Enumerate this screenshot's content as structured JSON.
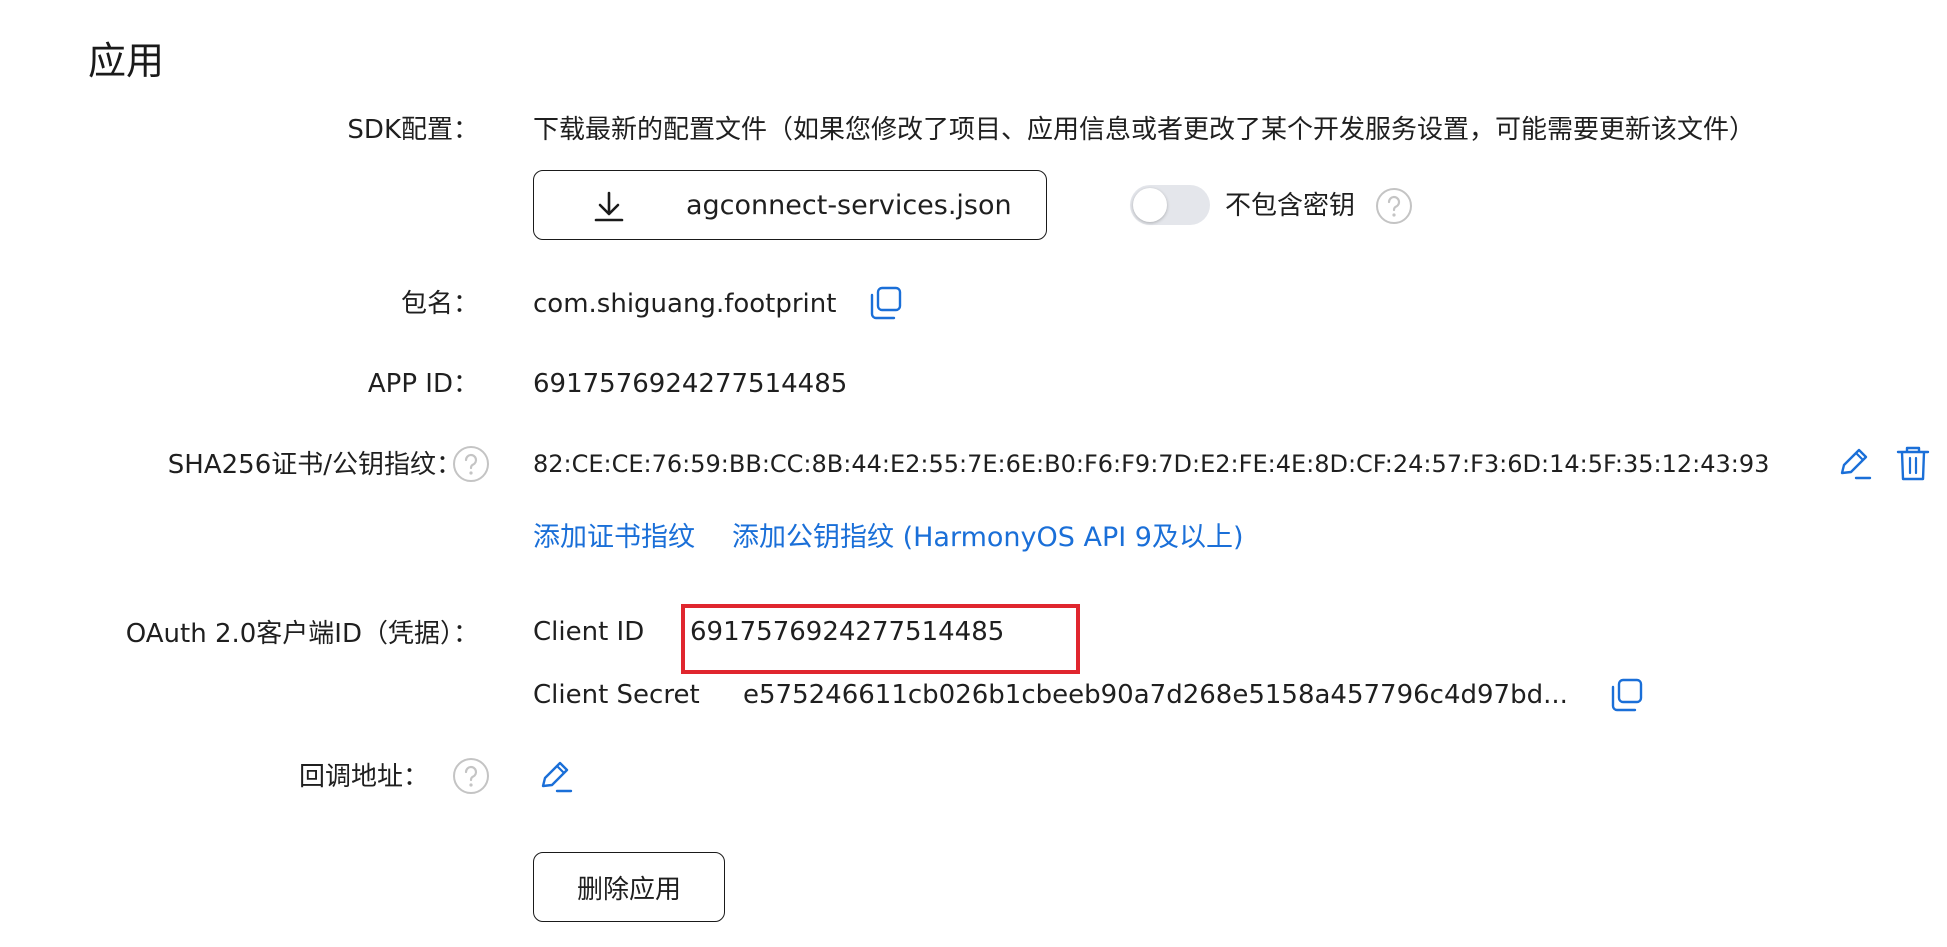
{
  "section": {
    "title": "应用"
  },
  "sdk": {
    "label": "SDK配置：",
    "description": "下载最新的配置文件（如果您修改了项目、应用信息或者更改了某个开发服务设置，可能需要更新该文件）",
    "download_label": "agconnect-services.json",
    "toggle_label": "不包含密钥",
    "toggle_on": false
  },
  "package": {
    "label": "包名：",
    "value": "com.shiguang.footprint"
  },
  "app_id": {
    "label": "APP ID：",
    "value": "6917576924277514485"
  },
  "sha256": {
    "label": "SHA256证书/公钥指纹：",
    "value": "82:CE:CE:76:59:BB:CC:8B:44:E2:55:7E:6E:B0:F6:F9:7D:E2:FE:4E:8D:CF:24:57:F3:6D:14:5F:35:12:43:93",
    "add_cert_link": "添加证书指纹",
    "add_pubkey_link": "添加公钥指纹 (HarmonyOS API 9及以上)"
  },
  "oauth": {
    "label": "OAuth 2.0客户端ID（凭据）：",
    "client_id_label": "Client ID",
    "client_id_value": "6917576924277514485",
    "client_secret_label": "Client Secret",
    "client_secret_value": "e575246611cb026b1cbeeb90a7d268e5158a457796c4d97bd..."
  },
  "callback": {
    "label": "回调地址："
  },
  "actions": {
    "delete_label": "删除应用"
  },
  "colors": {
    "accent": "#1a6fd8",
    "highlight": "#e0262e",
    "help_icon": "#c4c4c4"
  }
}
